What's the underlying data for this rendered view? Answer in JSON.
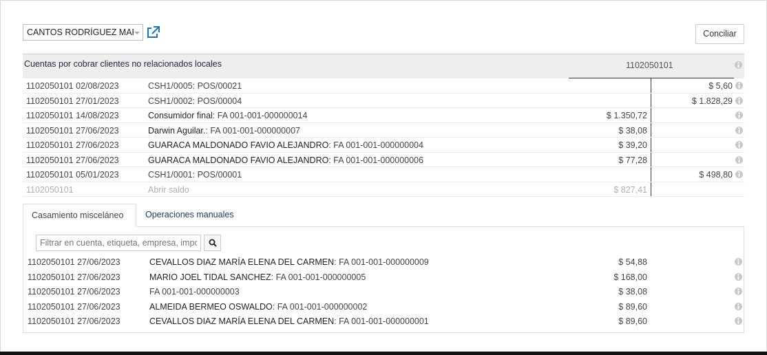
{
  "toolbar": {
    "partner_value": "CANTOS RODRÍGUEZ MARÍ",
    "reconcile_label": "Conciliar"
  },
  "account": {
    "name": "Cuentas por cobrar clientes no relacionados locales",
    "code": "1102050101"
  },
  "lines": [
    {
      "account": "1102050101",
      "date": "02/08/2023",
      "partner": "",
      "label": "CSH1/0005: POS/00021",
      "debit": "",
      "credit": "$ 5,60"
    },
    {
      "account": "1102050101",
      "date": "27/01/2023",
      "partner": "",
      "label": "CSH1/0002: POS/00004",
      "debit": "",
      "credit": "$ 1.828,29"
    },
    {
      "account": "1102050101",
      "date": "14/08/2023",
      "partner": "Consumidor final",
      "label": ": FA 001-001-000000014",
      "debit": "$ 1.350,72",
      "credit": ""
    },
    {
      "account": "1102050101",
      "date": "27/06/2023",
      "partner": "Darwin Aguilar.",
      "label": ": FA 001-001-000000007",
      "debit": "$ 38,08",
      "credit": ""
    },
    {
      "account": "1102050101",
      "date": "27/06/2023",
      "partner": "GUARACA MALDONADO FAVIO ALEJANDRO",
      "label": ": FA 001-001-000000004",
      "debit": "$ 39,20",
      "credit": ""
    },
    {
      "account": "1102050101",
      "date": "27/06/2023",
      "partner": "GUARACA MALDONADO FAVIO ALEJANDRO",
      "label": ": FA 001-001-000000006",
      "debit": "$ 77,28",
      "credit": ""
    },
    {
      "account": "1102050101",
      "date": "05/01/2023",
      "partner": "",
      "label": "CSH1/0001: POS/00001",
      "debit": "",
      "credit": "$ 498,80"
    }
  ],
  "open_balance": {
    "account": "1102050101",
    "label": "Abrir saldo",
    "debit": "$ 827,41"
  },
  "tabs": [
    {
      "label": "Casamiento misceláneo"
    },
    {
      "label": "Operaciones manuales"
    }
  ],
  "filter": {
    "placeholder": "Filtrar en cuenta, etiqueta, empresa, importe,..."
  },
  "misc_lines": [
    {
      "account": "1102050101",
      "date": "27/06/2023",
      "partner": "CEVALLOS DIAZ MARÍA ELENA DEL CARMEN",
      "label": ": FA 001-001-000000009",
      "debit": "$ 54,88"
    },
    {
      "account": "1102050101",
      "date": "27/06/2023",
      "partner": "MARIO JOEL TIDAL SANCHEZ",
      "label": ": FA 001-001-000000005",
      "debit": "$ 168,00"
    },
    {
      "account": "1102050101",
      "date": "27/06/2023",
      "partner": "",
      "label": "FA 001-001-000000003",
      "debit": "$ 38,08"
    },
    {
      "account": "1102050101",
      "date": "27/06/2023",
      "partner": "ALMEIDA BERMEO OSWALDO",
      "label": ": FA 001-001-000000002",
      "debit": "$ 89,60"
    },
    {
      "account": "1102050101",
      "date": "27/06/2023",
      "partner": "CEVALLOS DIAZ MARÍA ELENA DEL CARMEN",
      "label": ": FA 001-001-000000001",
      "debit": "$ 89,60"
    }
  ],
  "colors": {
    "accent": "#1a73c7",
    "header_bg": "#eeeeee",
    "link": "#1f3866"
  }
}
